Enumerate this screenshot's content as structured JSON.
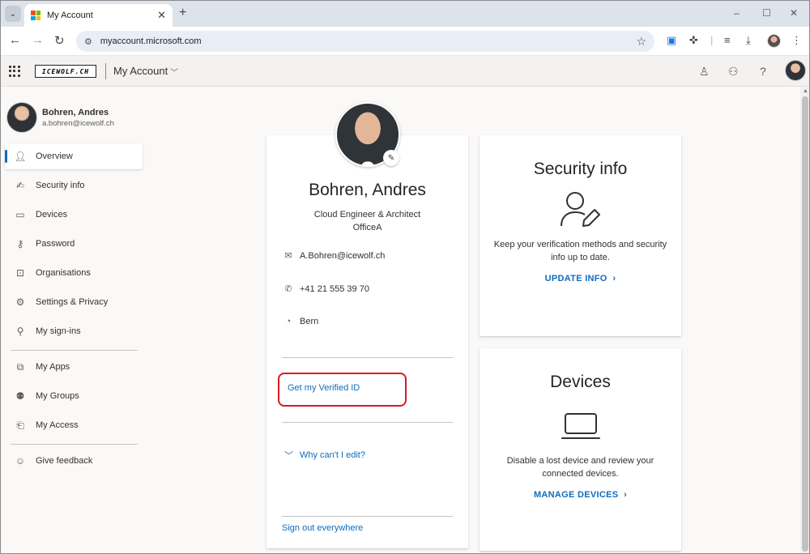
{
  "browser": {
    "tab_title": "My Account",
    "url": "myaccount.microsoft.com",
    "tab_close": "✕",
    "new_tab": "+",
    "controls": [
      "–",
      "☐",
      "✕"
    ]
  },
  "header": {
    "brand": "ICEWOLF.CH",
    "title": "My Account"
  },
  "user": {
    "name": "Bohren, Andres",
    "email": "a.bohren@icewolf.ch"
  },
  "sidebar": {
    "items": [
      {
        "label": "Overview",
        "icon": "person-icon"
      },
      {
        "label": "Security info",
        "icon": "security-info-icon"
      },
      {
        "label": "Devices",
        "icon": "laptop-icon"
      },
      {
        "label": "Password",
        "icon": "key-icon"
      },
      {
        "label": "Organisations",
        "icon": "briefcase-icon"
      },
      {
        "label": "Settings & Privacy",
        "icon": "gear-icon"
      },
      {
        "label": "My sign-ins",
        "icon": "signins-icon"
      },
      {
        "label": "My Apps",
        "icon": "apps-icon"
      },
      {
        "label": "My Groups",
        "icon": "groups-icon"
      },
      {
        "label": "My Access",
        "icon": "access-icon"
      },
      {
        "label": "Give feedback",
        "icon": "feedback-icon"
      }
    ]
  },
  "profile": {
    "name": "Bohren, Andres",
    "job_title": "Cloud Engineer & Architect",
    "office": "OfficeA",
    "email": "A.Bohren@icewolf.ch",
    "phone": "+41 21 555 39 70",
    "location": "Bern",
    "verified_id_link": "Get my Verified ID",
    "why_cant_edit": "Why can't I edit?",
    "sign_out": "Sign out everywhere"
  },
  "security_card": {
    "title": "Security info",
    "description": "Keep your verification methods and security info up to date.",
    "action": "UPDATE INFO"
  },
  "devices_card": {
    "title": "Devices",
    "description": "Disable a lost device and review your connected devices.",
    "action": "MANAGE DEVICES"
  },
  "colors": {
    "accent": "#0f6cbd",
    "highlight_box": "#d71b24"
  }
}
